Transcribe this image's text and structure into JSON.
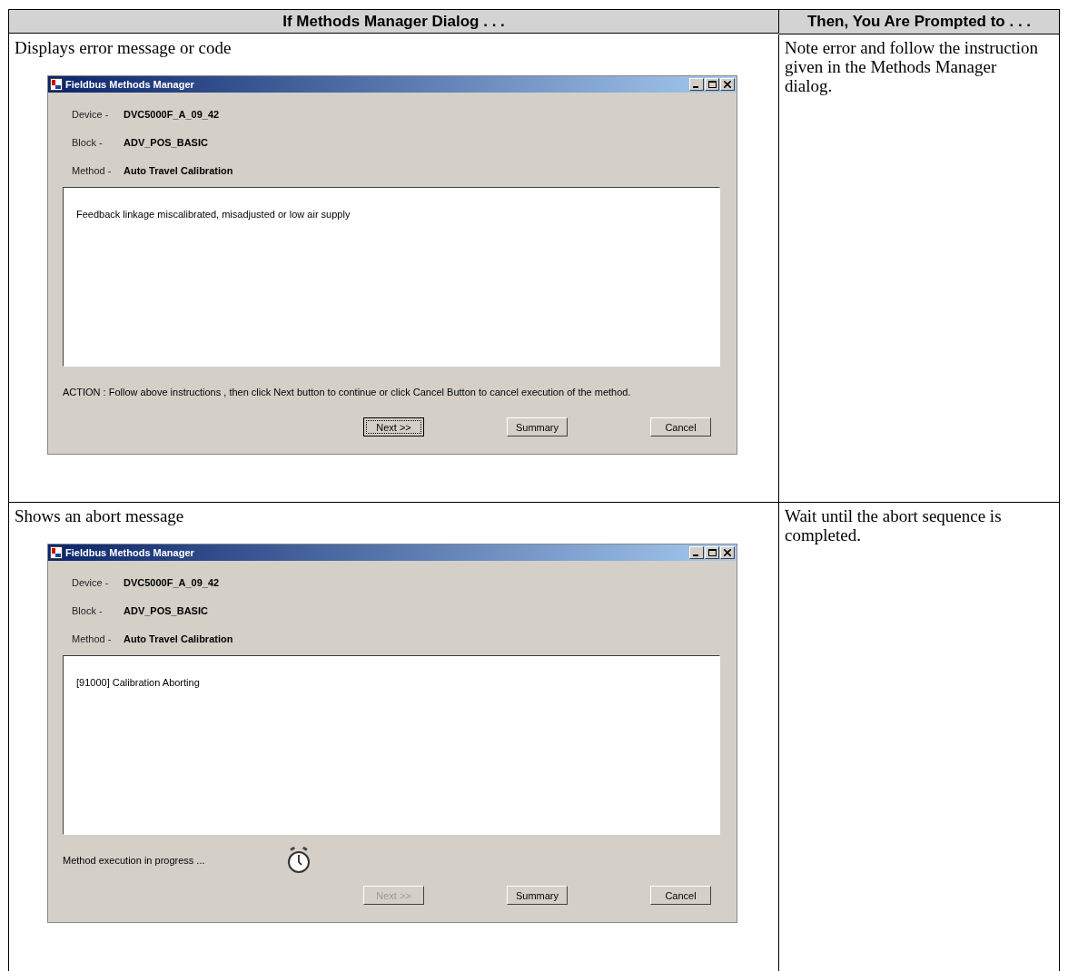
{
  "table": {
    "columns": [
      "If Methods Manager Dialog . . .",
      "Then, You Are Prompted to . . ."
    ],
    "rows": [
      {
        "condition": "Displays error message or code",
        "prompt": "Note error and follow the instruction given in the Methods Manager dialog.",
        "dialog": {
          "title": "Fieldbus Methods Manager",
          "fields": [
            {
              "label": "Device -",
              "value": "DVC5000F_A_09_42"
            },
            {
              "label": "Block -",
              "value": "ADV_POS_BASIC"
            },
            {
              "label": "Method -",
              "value": "Auto Travel Calibration"
            }
          ],
          "message": "Feedback linkage miscalibrated, misadjusted or low air supply",
          "status": {
            "kind": "action",
            "text": "ACTION : Follow above instructions , then click Next button to continue or click Cancel Button to cancel execution of the method."
          },
          "buttons": [
            {
              "label": "Next >>",
              "disabled": false,
              "focused": true
            },
            {
              "label": "Summary",
              "disabled": false,
              "focused": false
            },
            {
              "label": "Cancel",
              "disabled": false,
              "focused": false
            }
          ]
        }
      },
      {
        "condition": "Shows an abort message",
        "prompt": "Wait until the abort sequence is completed.",
        "dialog": {
          "title": "Fieldbus Methods Manager",
          "fields": [
            {
              "label": "Device -",
              "value": "DVC5000F_A_09_42"
            },
            {
              "label": "Block -",
              "value": "ADV_POS_BASIC"
            },
            {
              "label": "Method -",
              "value": "Auto Travel Calibration"
            }
          ],
          "message": "[91000] Calibration Aborting",
          "status": {
            "kind": "progress",
            "text": "Method execution in progress ..."
          },
          "buttons": [
            {
              "label": "Next >>",
              "disabled": true,
              "focused": false
            },
            {
              "label": "Summary",
              "disabled": false,
              "focused": false
            },
            {
              "label": "Cancel",
              "disabled": false,
              "focused": false
            }
          ]
        }
      }
    ]
  }
}
